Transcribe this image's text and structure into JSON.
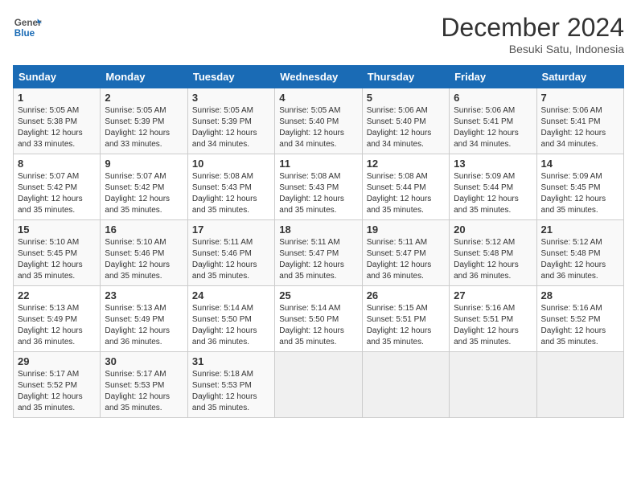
{
  "header": {
    "logo_general": "General",
    "logo_blue": "Blue",
    "month_title": "December 2024",
    "location": "Besuki Satu, Indonesia"
  },
  "weekdays": [
    "Sunday",
    "Monday",
    "Tuesday",
    "Wednesday",
    "Thursday",
    "Friday",
    "Saturday"
  ],
  "weeks": [
    [
      {
        "day": "1",
        "sunrise": "5:05 AM",
        "sunset": "5:38 PM",
        "daylight": "12 hours and 33 minutes."
      },
      {
        "day": "2",
        "sunrise": "5:05 AM",
        "sunset": "5:39 PM",
        "daylight": "12 hours and 33 minutes."
      },
      {
        "day": "3",
        "sunrise": "5:05 AM",
        "sunset": "5:39 PM",
        "daylight": "12 hours and 34 minutes."
      },
      {
        "day": "4",
        "sunrise": "5:05 AM",
        "sunset": "5:40 PM",
        "daylight": "12 hours and 34 minutes."
      },
      {
        "day": "5",
        "sunrise": "5:06 AM",
        "sunset": "5:40 PM",
        "daylight": "12 hours and 34 minutes."
      },
      {
        "day": "6",
        "sunrise": "5:06 AM",
        "sunset": "5:41 PM",
        "daylight": "12 hours and 34 minutes."
      },
      {
        "day": "7",
        "sunrise": "5:06 AM",
        "sunset": "5:41 PM",
        "daylight": "12 hours and 34 minutes."
      }
    ],
    [
      {
        "day": "8",
        "sunrise": "5:07 AM",
        "sunset": "5:42 PM",
        "daylight": "12 hours and 35 minutes."
      },
      {
        "day": "9",
        "sunrise": "5:07 AM",
        "sunset": "5:42 PM",
        "daylight": "12 hours and 35 minutes."
      },
      {
        "day": "10",
        "sunrise": "5:08 AM",
        "sunset": "5:43 PM",
        "daylight": "12 hours and 35 minutes."
      },
      {
        "day": "11",
        "sunrise": "5:08 AM",
        "sunset": "5:43 PM",
        "daylight": "12 hours and 35 minutes."
      },
      {
        "day": "12",
        "sunrise": "5:08 AM",
        "sunset": "5:44 PM",
        "daylight": "12 hours and 35 minutes."
      },
      {
        "day": "13",
        "sunrise": "5:09 AM",
        "sunset": "5:44 PM",
        "daylight": "12 hours and 35 minutes."
      },
      {
        "day": "14",
        "sunrise": "5:09 AM",
        "sunset": "5:45 PM",
        "daylight": "12 hours and 35 minutes."
      }
    ],
    [
      {
        "day": "15",
        "sunrise": "5:10 AM",
        "sunset": "5:45 PM",
        "daylight": "12 hours and 35 minutes."
      },
      {
        "day": "16",
        "sunrise": "5:10 AM",
        "sunset": "5:46 PM",
        "daylight": "12 hours and 35 minutes."
      },
      {
        "day": "17",
        "sunrise": "5:11 AM",
        "sunset": "5:46 PM",
        "daylight": "12 hours and 35 minutes."
      },
      {
        "day": "18",
        "sunrise": "5:11 AM",
        "sunset": "5:47 PM",
        "daylight": "12 hours and 35 minutes."
      },
      {
        "day": "19",
        "sunrise": "5:11 AM",
        "sunset": "5:47 PM",
        "daylight": "12 hours and 36 minutes."
      },
      {
        "day": "20",
        "sunrise": "5:12 AM",
        "sunset": "5:48 PM",
        "daylight": "12 hours and 36 minutes."
      },
      {
        "day": "21",
        "sunrise": "5:12 AM",
        "sunset": "5:48 PM",
        "daylight": "12 hours and 36 minutes."
      }
    ],
    [
      {
        "day": "22",
        "sunrise": "5:13 AM",
        "sunset": "5:49 PM",
        "daylight": "12 hours and 36 minutes."
      },
      {
        "day": "23",
        "sunrise": "5:13 AM",
        "sunset": "5:49 PM",
        "daylight": "12 hours and 36 minutes."
      },
      {
        "day": "24",
        "sunrise": "5:14 AM",
        "sunset": "5:50 PM",
        "daylight": "12 hours and 36 minutes."
      },
      {
        "day": "25",
        "sunrise": "5:14 AM",
        "sunset": "5:50 PM",
        "daylight": "12 hours and 35 minutes."
      },
      {
        "day": "26",
        "sunrise": "5:15 AM",
        "sunset": "5:51 PM",
        "daylight": "12 hours and 35 minutes."
      },
      {
        "day": "27",
        "sunrise": "5:16 AM",
        "sunset": "5:51 PM",
        "daylight": "12 hours and 35 minutes."
      },
      {
        "day": "28",
        "sunrise": "5:16 AM",
        "sunset": "5:52 PM",
        "daylight": "12 hours and 35 minutes."
      }
    ],
    [
      {
        "day": "29",
        "sunrise": "5:17 AM",
        "sunset": "5:52 PM",
        "daylight": "12 hours and 35 minutes."
      },
      {
        "day": "30",
        "sunrise": "5:17 AM",
        "sunset": "5:53 PM",
        "daylight": "12 hours and 35 minutes."
      },
      {
        "day": "31",
        "sunrise": "5:18 AM",
        "sunset": "5:53 PM",
        "daylight": "12 hours and 35 minutes."
      },
      null,
      null,
      null,
      null
    ]
  ]
}
